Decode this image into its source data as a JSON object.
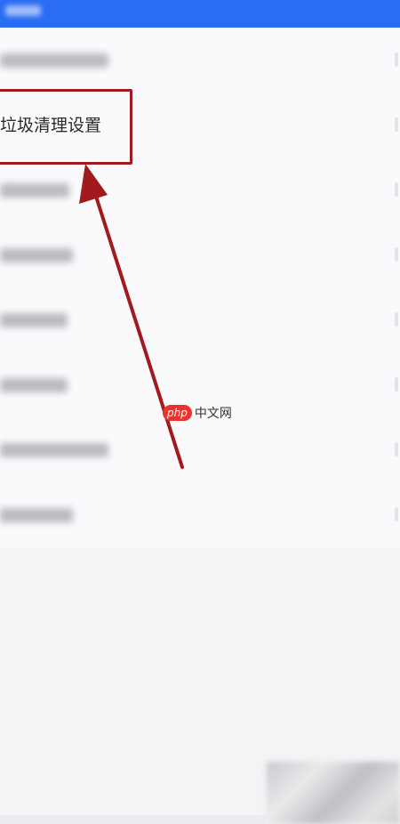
{
  "highlighted_item": {
    "label": "垃圾清理设置"
  },
  "watermark": {
    "badge": "php",
    "text": "中文网"
  },
  "colors": {
    "top_bar": "#2a6cf3",
    "annotation_red": "#a11a1e"
  },
  "icons": {
    "row_chevron": "chevron-right-icon",
    "annotation": "arrow-icon"
  }
}
